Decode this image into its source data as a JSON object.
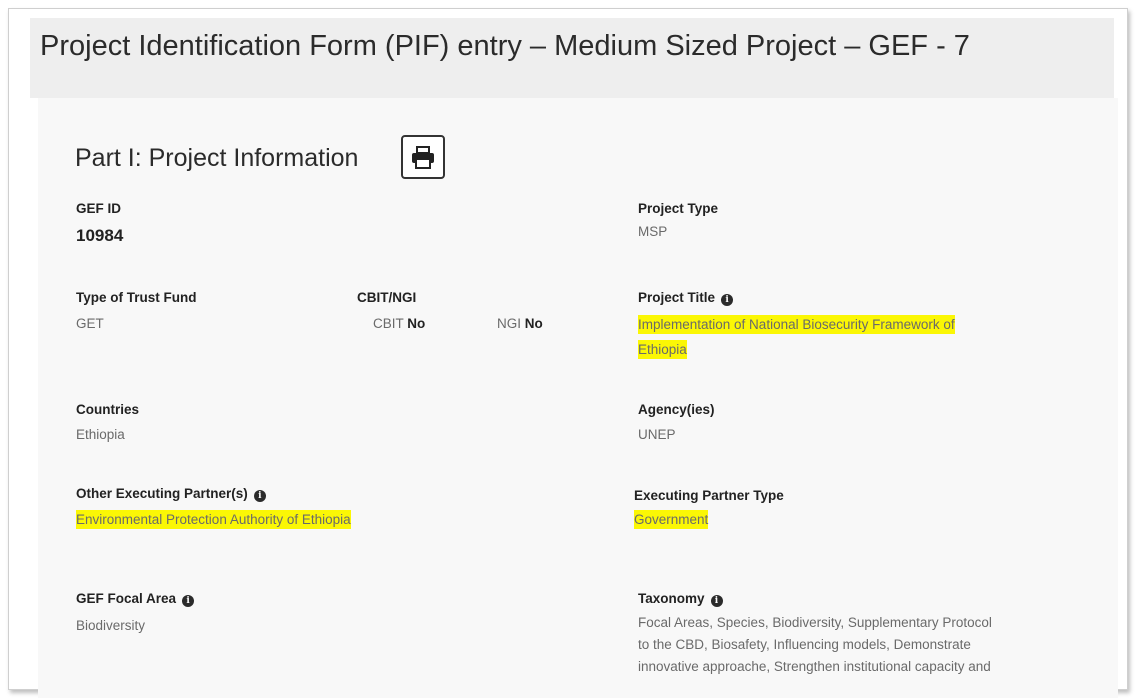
{
  "page": {
    "title": "Project Identification Form (PIF) entry – Medium Sized Project – GEF - 7"
  },
  "part": {
    "heading": "Part I: Project Information"
  },
  "fields": {
    "gef_id": {
      "label": "GEF ID",
      "value": "10984"
    },
    "project_type": {
      "label": "Project Type",
      "value": "MSP"
    },
    "trust_fund": {
      "label": "Type of Trust Fund",
      "value": "GET"
    },
    "cbit_ngi": {
      "label": "CBIT/NGI",
      "cbit_label": "CBIT",
      "cbit_value": "No",
      "ngi_label": "NGI",
      "ngi_value": "No"
    },
    "project_title": {
      "label": "Project Title",
      "line1": "Implementation of National Biosecurity Framework of",
      "line2": "Ethiopia"
    },
    "countries": {
      "label": "Countries",
      "value": "Ethiopia"
    },
    "agencies": {
      "label": "Agency(ies)",
      "value": "UNEP"
    },
    "other_partners": {
      "label": "Other Executing Partner(s)",
      "value": "Environmental Protection Authority of Ethiopia"
    },
    "partner_type": {
      "label": "Executing Partner Type",
      "value": "Government"
    },
    "focal_area": {
      "label": "GEF Focal Area",
      "value": "Biodiversity"
    },
    "taxonomy": {
      "label": "Taxonomy",
      "line1": "Focal Areas, Species, Biodiversity, Supplementary Protocol",
      "line2": "to the CBD, Biosafety, Influencing models, Demonstrate",
      "line3": "innovative approache, Strengthen institutional capacity and"
    }
  },
  "icons": {
    "info": "info-icon",
    "print": "printer-icon"
  },
  "colors": {
    "highlight": "#fbf705",
    "band": "#eeeeee",
    "panel": "#f8f8f8"
  }
}
